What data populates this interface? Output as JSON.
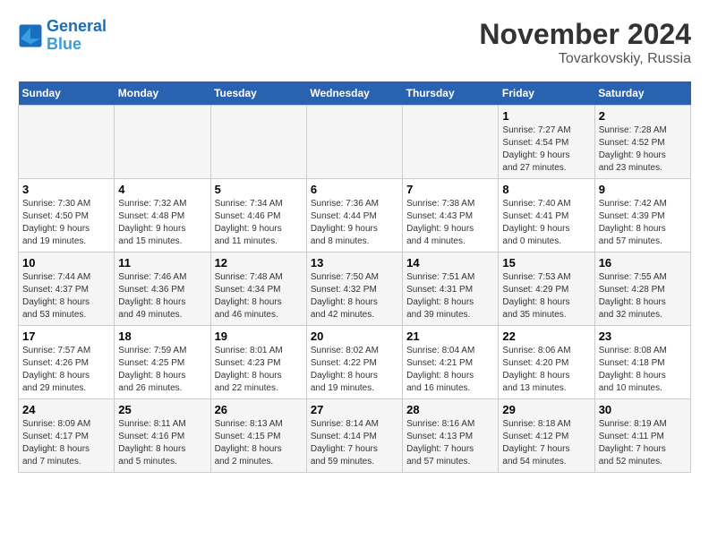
{
  "logo": {
    "line1": "General",
    "line2": "Blue"
  },
  "title": "November 2024",
  "subtitle": "Tovarkovskiy, Russia",
  "days_of_week": [
    "Sunday",
    "Monday",
    "Tuesday",
    "Wednesday",
    "Thursday",
    "Friday",
    "Saturday"
  ],
  "weeks": [
    [
      {
        "day": "",
        "info": ""
      },
      {
        "day": "",
        "info": ""
      },
      {
        "day": "",
        "info": ""
      },
      {
        "day": "",
        "info": ""
      },
      {
        "day": "",
        "info": ""
      },
      {
        "day": "1",
        "info": "Sunrise: 7:27 AM\nSunset: 4:54 PM\nDaylight: 9 hours\nand 27 minutes."
      },
      {
        "day": "2",
        "info": "Sunrise: 7:28 AM\nSunset: 4:52 PM\nDaylight: 9 hours\nand 23 minutes."
      }
    ],
    [
      {
        "day": "3",
        "info": "Sunrise: 7:30 AM\nSunset: 4:50 PM\nDaylight: 9 hours\nand 19 minutes."
      },
      {
        "day": "4",
        "info": "Sunrise: 7:32 AM\nSunset: 4:48 PM\nDaylight: 9 hours\nand 15 minutes."
      },
      {
        "day": "5",
        "info": "Sunrise: 7:34 AM\nSunset: 4:46 PM\nDaylight: 9 hours\nand 11 minutes."
      },
      {
        "day": "6",
        "info": "Sunrise: 7:36 AM\nSunset: 4:44 PM\nDaylight: 9 hours\nand 8 minutes."
      },
      {
        "day": "7",
        "info": "Sunrise: 7:38 AM\nSunset: 4:43 PM\nDaylight: 9 hours\nand 4 minutes."
      },
      {
        "day": "8",
        "info": "Sunrise: 7:40 AM\nSunset: 4:41 PM\nDaylight: 9 hours\nand 0 minutes."
      },
      {
        "day": "9",
        "info": "Sunrise: 7:42 AM\nSunset: 4:39 PM\nDaylight: 8 hours\nand 57 minutes."
      }
    ],
    [
      {
        "day": "10",
        "info": "Sunrise: 7:44 AM\nSunset: 4:37 PM\nDaylight: 8 hours\nand 53 minutes."
      },
      {
        "day": "11",
        "info": "Sunrise: 7:46 AM\nSunset: 4:36 PM\nDaylight: 8 hours\nand 49 minutes."
      },
      {
        "day": "12",
        "info": "Sunrise: 7:48 AM\nSunset: 4:34 PM\nDaylight: 8 hours\nand 46 minutes."
      },
      {
        "day": "13",
        "info": "Sunrise: 7:50 AM\nSunset: 4:32 PM\nDaylight: 8 hours\nand 42 minutes."
      },
      {
        "day": "14",
        "info": "Sunrise: 7:51 AM\nSunset: 4:31 PM\nDaylight: 8 hours\nand 39 minutes."
      },
      {
        "day": "15",
        "info": "Sunrise: 7:53 AM\nSunset: 4:29 PM\nDaylight: 8 hours\nand 35 minutes."
      },
      {
        "day": "16",
        "info": "Sunrise: 7:55 AM\nSunset: 4:28 PM\nDaylight: 8 hours\nand 32 minutes."
      }
    ],
    [
      {
        "day": "17",
        "info": "Sunrise: 7:57 AM\nSunset: 4:26 PM\nDaylight: 8 hours\nand 29 minutes."
      },
      {
        "day": "18",
        "info": "Sunrise: 7:59 AM\nSunset: 4:25 PM\nDaylight: 8 hours\nand 26 minutes."
      },
      {
        "day": "19",
        "info": "Sunrise: 8:01 AM\nSunset: 4:23 PM\nDaylight: 8 hours\nand 22 minutes."
      },
      {
        "day": "20",
        "info": "Sunrise: 8:02 AM\nSunset: 4:22 PM\nDaylight: 8 hours\nand 19 minutes."
      },
      {
        "day": "21",
        "info": "Sunrise: 8:04 AM\nSunset: 4:21 PM\nDaylight: 8 hours\nand 16 minutes."
      },
      {
        "day": "22",
        "info": "Sunrise: 8:06 AM\nSunset: 4:20 PM\nDaylight: 8 hours\nand 13 minutes."
      },
      {
        "day": "23",
        "info": "Sunrise: 8:08 AM\nSunset: 4:18 PM\nDaylight: 8 hours\nand 10 minutes."
      }
    ],
    [
      {
        "day": "24",
        "info": "Sunrise: 8:09 AM\nSunset: 4:17 PM\nDaylight: 8 hours\nand 7 minutes."
      },
      {
        "day": "25",
        "info": "Sunrise: 8:11 AM\nSunset: 4:16 PM\nDaylight: 8 hours\nand 5 minutes."
      },
      {
        "day": "26",
        "info": "Sunrise: 8:13 AM\nSunset: 4:15 PM\nDaylight: 8 hours\nand 2 minutes."
      },
      {
        "day": "27",
        "info": "Sunrise: 8:14 AM\nSunset: 4:14 PM\nDaylight: 7 hours\nand 59 minutes."
      },
      {
        "day": "28",
        "info": "Sunrise: 8:16 AM\nSunset: 4:13 PM\nDaylight: 7 hours\nand 57 minutes."
      },
      {
        "day": "29",
        "info": "Sunrise: 8:18 AM\nSunset: 4:12 PM\nDaylight: 7 hours\nand 54 minutes."
      },
      {
        "day": "30",
        "info": "Sunrise: 8:19 AM\nSunset: 4:11 PM\nDaylight: 7 hours\nand 52 minutes."
      }
    ]
  ]
}
